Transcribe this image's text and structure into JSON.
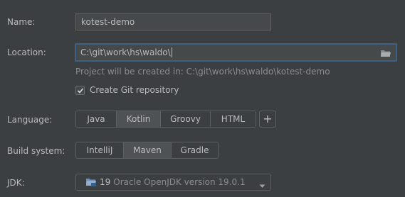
{
  "form": {
    "name": {
      "label": "Name:",
      "value": "kotest-demo"
    },
    "location": {
      "label": "Location:",
      "value": "C:\\git\\work\\hs\\waldo\\",
      "hint": "Project will be created in: C:\\git\\work\\hs\\waldo\\kotest-demo",
      "browse_icon": "folder-icon"
    },
    "git": {
      "label": "Create Git repository",
      "checked": true
    },
    "language": {
      "label": "Language:",
      "options": [
        "Java",
        "Kotlin",
        "Groovy",
        "HTML"
      ],
      "selected": "Kotlin",
      "add_label": "+"
    },
    "build_system": {
      "label": "Build system:",
      "options": [
        "IntelliJ",
        "Maven",
        "Gradle"
      ],
      "selected": "Maven"
    },
    "jdk": {
      "label": "JDK:",
      "version": "19",
      "description": "Oracle OpenJDK version 19.0.1",
      "icon": "jdk-folder-icon"
    }
  },
  "colors": {
    "background": "#3c3f41",
    "text": "#bbbbbb",
    "hint": "#8c8c8c",
    "focus_border": "#3d6185"
  }
}
